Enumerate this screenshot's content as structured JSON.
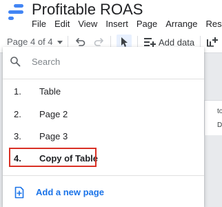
{
  "app": {
    "title": "Profitable ROAS"
  },
  "menu": [
    "File",
    "Edit",
    "View",
    "Insert",
    "Page",
    "Arrange",
    "Reso"
  ],
  "toolbar": {
    "page_selector": "Page 4 of 4",
    "add_data_label": "Add data"
  },
  "dropdown": {
    "search_placeholder": "Search",
    "pages": [
      {
        "number": "1.",
        "name": "Table"
      },
      {
        "number": "2.",
        "name": "Page 2"
      },
      {
        "number": "3.",
        "name": "Page 3"
      },
      {
        "number": "4.",
        "name": "Copy of Table"
      }
    ],
    "active_page_index": 3,
    "add_page_label": "Add a new page"
  },
  "background_fragments": [
    "to",
    "Di"
  ],
  "colors": {
    "brand_blue": "#4285f4",
    "link_blue": "#1a73e8",
    "highlight_red": "#d93025",
    "select_tool_bg": "#e8f0fe"
  },
  "icons": {
    "logo": "looker-studio-logo",
    "undo": "undo-icon",
    "redo": "redo-icon",
    "select": "cursor-arrow-icon",
    "add_data": "add-data-icon",
    "add_chart": "add-chart-icon",
    "search": "search-icon",
    "add_page": "add-page-icon"
  }
}
